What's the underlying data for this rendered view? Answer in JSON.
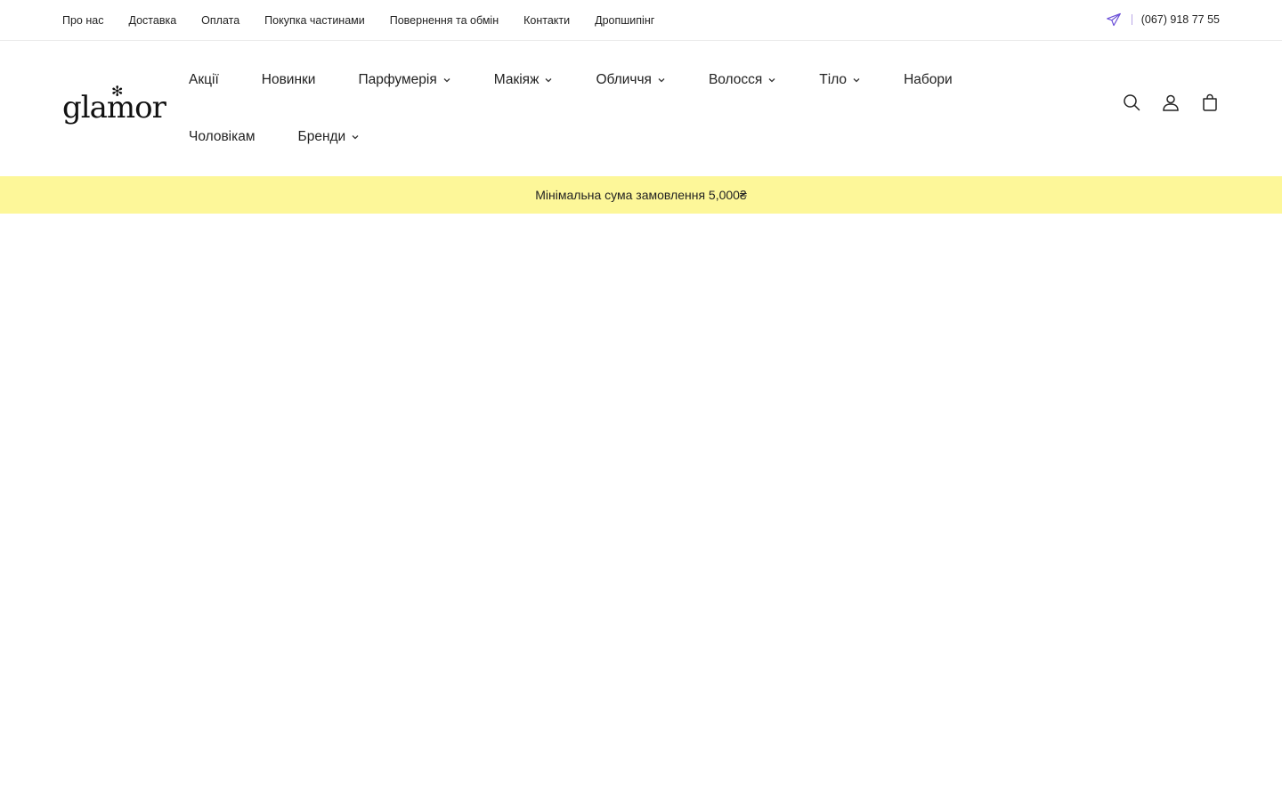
{
  "topbar": {
    "links": [
      "Про нас",
      "Доставка",
      "Оплата",
      "Покупка частинами",
      "Повернення та обмін",
      "Контакти",
      "Дропшипінг"
    ],
    "telegram_icon": "telegram-icon",
    "phone": "(067) 918 77 55"
  },
  "header": {
    "logo_text": "glamor",
    "nav": [
      "Акції",
      "Новинки",
      "Парфумерія",
      "Макіяж",
      "Обличчя",
      "Волосся",
      "Тіло",
      "Набори",
      "Чоловікам",
      "Бренди"
    ],
    "icons": [
      "search-icon",
      "account-icon",
      "cart-icon"
    ]
  },
  "announcement": {
    "text": "Мінімальна сума замовлення 5,000₴"
  },
  "colors": {
    "announcement_bg": "#fdf799",
    "telegram": "#6b4fd8",
    "text": "#1a1a1a"
  }
}
